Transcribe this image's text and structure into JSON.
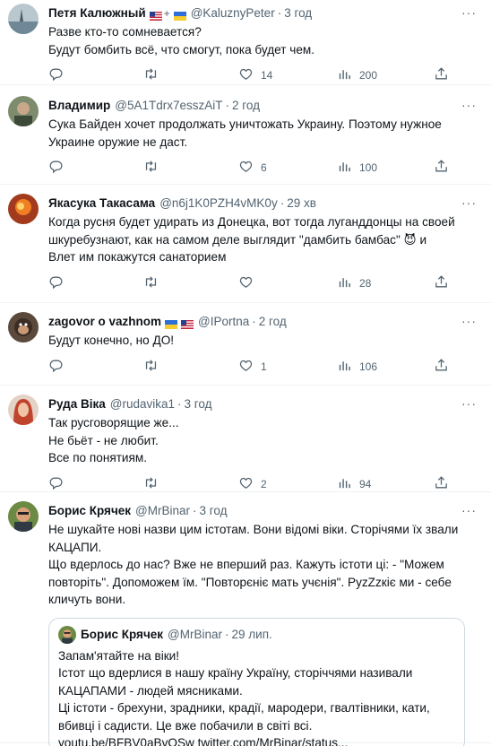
{
  "colors": {
    "secondary": "#536471",
    "border": "#eff3f4",
    "text": "#0f1419"
  },
  "tweets": [
    {
      "name": "Петя Калюжный",
      "handle": "@KaluznyPeter",
      "time": "3 год",
      "lines": [
        "Разве кто-то сомневается?",
        "Будут бомбить всё, что смогут, пока будет чем."
      ],
      "likes": "14",
      "views": "200",
      "flags": [
        "us",
        "ua"
      ]
    },
    {
      "name": "Владимир",
      "handle": "@5A1Tdrx7esszAiT",
      "time": "2 год",
      "lines": [
        "Сука Байден хочет продолжать уничтожать Украину. Поэтому нужное",
        "Украине оружие не даст."
      ],
      "likes": "6",
      "views": "100"
    },
    {
      "name": "Якасука Такасама",
      "handle": "@n6j1K0PZH4vMK0y",
      "time": "29 хв",
      "lines": [
        "Когда русня будет удирать из Донецка, вот тогда луганддонцы на своей",
        "шкуребузнают, как на самом деле выглядит \"дамбить бамбас\" 😈 и",
        "Влет им покажутся санаторием"
      ],
      "likes": "",
      "views": "28"
    },
    {
      "name": "zagovor o vazhnom",
      "handle": "@IPortna",
      "time": "2 год",
      "lines": [
        "Будут конечно, но ДО!"
      ],
      "likes": "1",
      "views": "106",
      "flags": [
        "ua",
        "us"
      ]
    },
    {
      "name": "Руда Віка",
      "handle": "@rudavika1",
      "time": "3 год",
      "lines": [
        "Так русговорящие же...",
        "Не бьёт - не любит.",
        "Все по понятиям."
      ],
      "likes": "2",
      "views": "94"
    },
    {
      "name": "Борис Крячек",
      "handle": "@MrBinar",
      "time": "3 год",
      "lines": [
        "Не шукайте нові назви цим істотам. Вони відомі віки. Сторічями їх звали",
        "КАЦАПИ.",
        "Що вдерлось до нас? Вже не вперший раз. Кажуть істоти ці: - \"Можем",
        "повторіть\". Допоможем їм. \"Повторєніє мать учєнія\". РyzZzкіє ми - себе",
        "кличуть вони."
      ],
      "quote": {
        "name": "Борис Крячек",
        "handle": "@MrBinar",
        "time": "29 лип.",
        "lines": [
          "Запам'ятайте на віки!",
          "Істот що вдерлися в нашу країну Україну, сторіччями називали",
          "КАЦАПАМИ - людей мясниками.",
          "Ці істоти - брехуни, зрадники, крадії, мародери, гвалтівники, кати,",
          "вбивці і садисти. Це вже побачили в світі всі.",
          "youtu.be/BFBV0aBvQSw twitter.com/MrBinar/status..."
        ]
      }
    }
  ]
}
